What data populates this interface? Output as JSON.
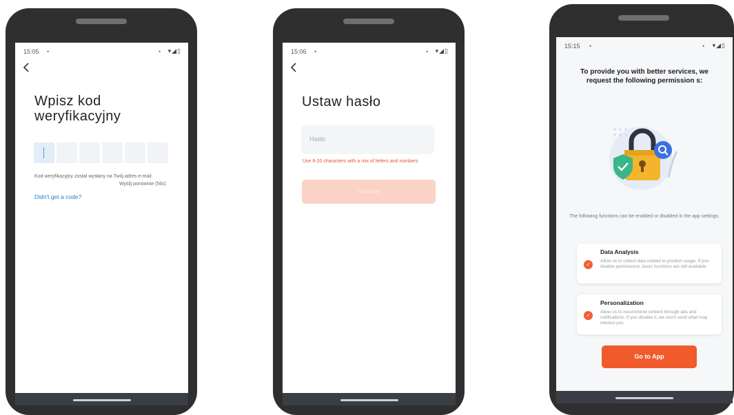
{
  "colors": {
    "phone_body": "#2f2f2f",
    "accent": "#f15a2b",
    "link": "#1c7ec9",
    "error": "#e4572e",
    "disabled_button": "#fbd3c6"
  },
  "phone1": {
    "status": {
      "time": "15:05",
      "icons": "▾◢▯"
    },
    "back_icon": "chevron-left-icon",
    "title_line1": "Wpisz kod",
    "title_line2": "weryfikacyjny",
    "code_boxes": [
      "",
      "",
      "",
      "",
      "",
      ""
    ],
    "info": "Kod weryfikacyjny został wysłany na Twój adres e-mail:",
    "resend": "Wyślij ponownie (56s)",
    "link": "Didn't get a code?"
  },
  "phone2": {
    "status": {
      "time": "15:06",
      "icons": "▾◢▯"
    },
    "back_icon": "chevron-left-icon",
    "title": "Ustaw hasło",
    "password_placeholder": "Hasło",
    "hint": "Use 6-20 characters with a mix of letters and numbers",
    "done_label": "Gotowe"
  },
  "phone3": {
    "status": {
      "time": "15:15",
      "icons": "▾◢▯"
    },
    "title": "To provide you with better services, we request the following permission s:",
    "subtitle": "The following functions can be enabled or disabled in the app settings.",
    "cards": [
      {
        "title": "Data Analysis",
        "description": "Allow us to collect data related to product usage. If you disable permissions, basic functions are still available."
      },
      {
        "title": "Personalization",
        "description": "Allow us to recommend content through ads and notifications. If you disable it, we won't send what may interest you."
      }
    ],
    "go_label": "Go to App",
    "illustration_icons": [
      "padlock-icon",
      "shield-check-icon",
      "magnifier-icon"
    ]
  }
}
